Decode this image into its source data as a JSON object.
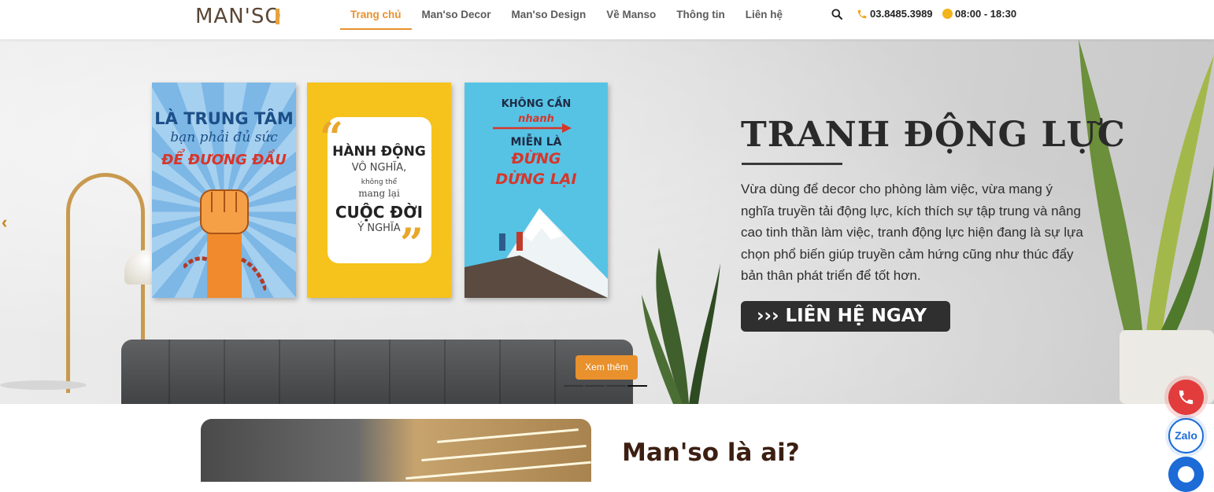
{
  "header": {
    "logo": "MAN'SO",
    "nav": [
      "Trang chủ",
      "Man'so Decor",
      "Man'so Design",
      "Về Manso",
      "Thông tin",
      "Liên hệ"
    ],
    "active_nav": "Trang chủ",
    "phone": "03.8485.3989",
    "hours": "08:00 - 18:30"
  },
  "banner": {
    "title": "TRANH ĐỘNG LỰC",
    "description": "Vừa dùng để decor cho phòng làm việc, vừa mang ý nghĩa truyền tải động lực, kích thích sự tập trung và nâng cao tinh thần làm việc, tranh động lực hiện đang là sự lựa chọn phổ biến giúp truyền cảm hứng cũng như thúc đẩy bản thân phát triển để tốt hơn.",
    "cta": "LIÊN HỆ NGAY",
    "more_button": "Xem thêm",
    "poster1": [
      "LÀ TRUNG TÂM",
      "bạn phải đủ sức",
      "ĐỂ ĐƯƠNG ĐẦU"
    ],
    "poster2": [
      "HÀNH ĐỘNG",
      "VÔ NGHĨA,",
      "không thể",
      "mang lại",
      "CUỘC ĐỜI",
      "Ý NGHĨA"
    ],
    "poster3": [
      "KHÔNG CẦN",
      "nhanh",
      "MIỄN LÀ",
      "ĐỪNG",
      "DỪNG LẠI"
    ],
    "slide_count": 4,
    "active_slide": 4,
    "colors": {
      "accent": "#e8912d",
      "cta_bg": "#2f2f2f"
    }
  },
  "about": {
    "title": "Man'so là ai?"
  },
  "floating": {
    "zalo": "Zalo"
  }
}
